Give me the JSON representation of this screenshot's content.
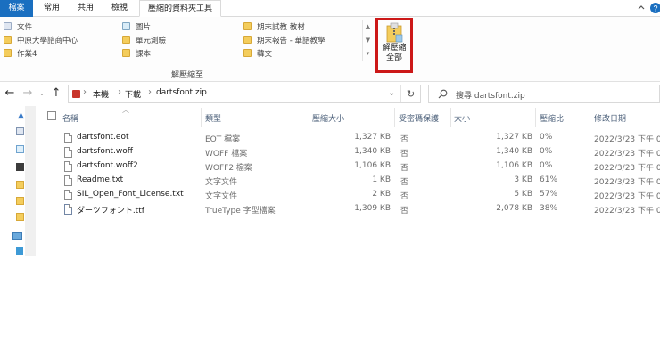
{
  "ribbon": {
    "tabs": [
      {
        "label": "檔案"
      },
      {
        "label": "常用"
      },
      {
        "label": "共用"
      },
      {
        "label": "檢視"
      },
      {
        "label": "壓縮的資料夾工具"
      }
    ],
    "destinations": [
      {
        "label": "文件",
        "icon": "document-icon"
      },
      {
        "label": "中原大學諮商中心",
        "icon": "folder-icon"
      },
      {
        "label": "作業4",
        "icon": "folder-icon"
      },
      {
        "label": "圖片",
        "icon": "picture-icon"
      },
      {
        "label": "單元測驗",
        "icon": "folder-icon"
      },
      {
        "label": "課本",
        "icon": "folder-icon"
      },
      {
        "label": "期末試教 教材",
        "icon": "folder-icon"
      },
      {
        "label": "期末報告 - 華語教學",
        "icon": "folder-icon"
      },
      {
        "label": "韓文一",
        "icon": "folder-icon"
      }
    ],
    "group_label": "解壓縮至",
    "extract_all": {
      "line1": "解壓縮",
      "line2": "全部"
    }
  },
  "address": {
    "crumbs": [
      "本機",
      "下載",
      "dartsfont.zip"
    ],
    "search_placeholder": "搜尋 dartsfont.zip"
  },
  "columns": {
    "name": "名稱",
    "type": "類型",
    "compressed": "壓縮大小",
    "protected": "受密碼保護",
    "size": "大小",
    "ratio": "壓縮比",
    "modified": "修改日期"
  },
  "files": [
    {
      "name": "dartsfont.eot",
      "type": "EOT 檔案",
      "compressed": "1,327 KB",
      "protected": "否",
      "size": "1,327 KB",
      "ratio": "0%",
      "modified": "2022/3/23 下午 0"
    },
    {
      "name": "dartsfont.woff",
      "type": "WOFF 檔案",
      "compressed": "1,340 KB",
      "protected": "否",
      "size": "1,340 KB",
      "ratio": "0%",
      "modified": "2022/3/23 下午 0"
    },
    {
      "name": "dartsfont.woff2",
      "type": "WOFF2 檔案",
      "compressed": "1,106 KB",
      "protected": "否",
      "size": "1,106 KB",
      "ratio": "0%",
      "modified": "2022/3/23 下午 0"
    },
    {
      "name": "Readme.txt",
      "type": "文字文件",
      "compressed": "1 KB",
      "protected": "否",
      "size": "3 KB",
      "ratio": "61%",
      "modified": "2022/3/23 下午 0"
    },
    {
      "name": "SIL_Open_Font_License.txt",
      "type": "文字文件",
      "compressed": "2 KB",
      "protected": "否",
      "size": "5 KB",
      "ratio": "57%",
      "modified": "2022/3/23 下午 0"
    },
    {
      "name": "ダーツフォント.ttf",
      "type": "TrueType 字型檔案",
      "compressed": "1,309 KB",
      "protected": "否",
      "size": "2,078 KB",
      "ratio": "38%",
      "modified": "2022/3/23 下午 0"
    }
  ],
  "colors": {
    "accent": "#1a6fc0",
    "highlight_border": "#cc1818",
    "header_text": "#4c607a"
  }
}
